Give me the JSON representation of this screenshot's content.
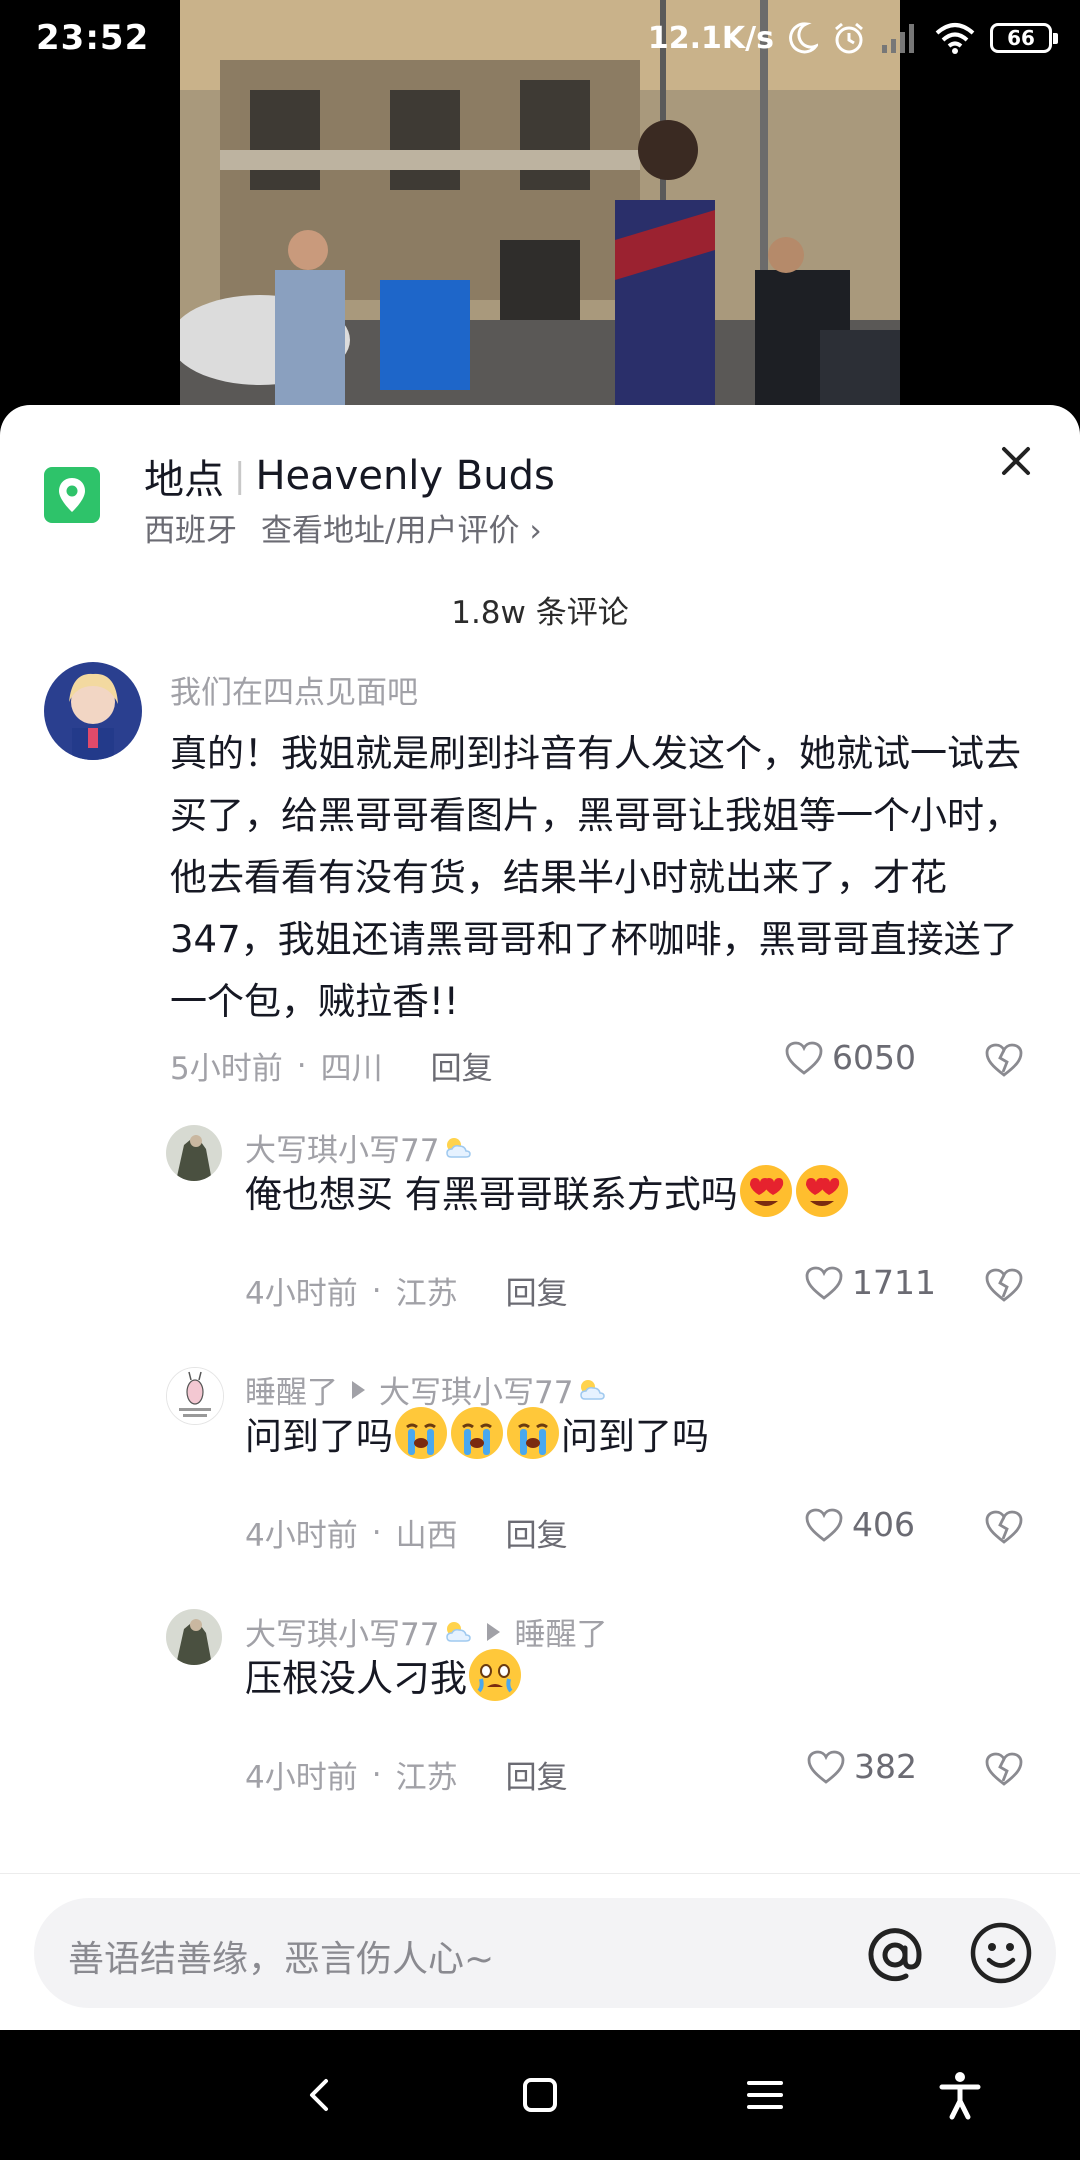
{
  "status_bar": {
    "time": "23:52",
    "network_speed": "12.1K/s",
    "battery": "66",
    "icons": [
      "moon-icon",
      "alarm-icon",
      "signal-icon",
      "wifi-icon",
      "battery-icon"
    ]
  },
  "location": {
    "label": "地点",
    "name": "Heavenly Buds",
    "country": "西班牙",
    "link_text": "查看地址/用户评价",
    "link_chevron": "›"
  },
  "comments_count": "1.8w 条评论",
  "comments": [
    {
      "author": "我们在四点见面吧",
      "text": "真的！我姐就是刷到抖音有人发这个，她就试一试去买了，给黑哥哥看图片，黑哥哥让我姐等一个小时，他去看看有没有货，结果半小时就出来了，才花347，我姐还请黑哥哥和了杯咖啡，黑哥哥直接送了一个包，贼拉香!!",
      "time": "5小时前",
      "region": "四川",
      "reply_label": "回复",
      "likes": "6050"
    }
  ],
  "replies": [
    {
      "author": "大写琪小写77",
      "text_before_emoji": "俺也想买 有黑哥哥联系方式吗",
      "time": "4小时前",
      "region": "江苏",
      "reply_label": "回复",
      "likes": "1711"
    },
    {
      "author": "睡醒了",
      "reply_to": "大写琪小写77",
      "text_before_emoji": "问到了吗",
      "text_after_emoji": "问到了吗",
      "time": "4小时前",
      "region": "山西",
      "reply_label": "回复",
      "likes": "406"
    },
    {
      "author": "大写琪小写77",
      "reply_to": "睡醒了",
      "text_before_emoji": "压根没人刁我",
      "time": "4小时前",
      "region": "江苏",
      "reply_label": "回复",
      "likes": "382"
    }
  ],
  "meta_separator": "·",
  "input": {
    "placeholder": "善语结善缘，恶言伤人心~"
  },
  "colors": {
    "accent_green": "#2ec36a",
    "text_primary": "#161823",
    "text_secondary": "#a1a1a7"
  }
}
